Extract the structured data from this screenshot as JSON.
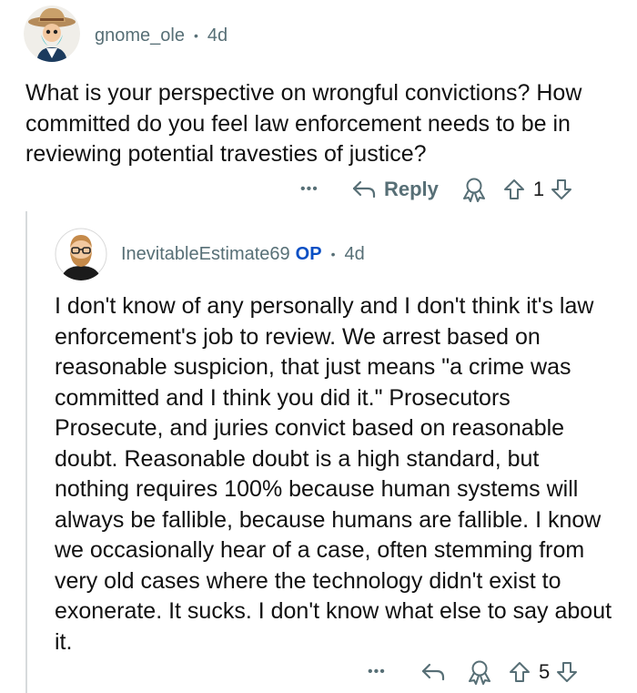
{
  "comment": {
    "username": "gnome_ole",
    "separator": "•",
    "age": "4d",
    "body": "What is your perspective on wrongful convictions? How committed do you feel law enforcement needs to be in reviewing potential travesties of justice?",
    "actions": {
      "more": "•••",
      "reply_label": "Reply",
      "vote_count": "1"
    }
  },
  "reply": {
    "username": "InevitableEstimate69",
    "op_badge": "OP",
    "separator": "•",
    "age": "4d",
    "body": "I don't know of any personally and I don't think it's law enforcement's job to review. We arrest based on reasonable suspicion, that just means \"a crime was committed and I think you did it.\" Prosecutors Prosecute, and juries convict based on reasonable doubt. Reasonable doubt is a high standard, but nothing requires 100% because human systems will always be fallible, because humans are fallible. I know we occasionally hear of a case, often stemming from very old cases where the technology didn't exist to exonerate. It sucks. I don't know what else to say about it.",
    "actions": {
      "more": "•••",
      "vote_count": "5"
    }
  }
}
